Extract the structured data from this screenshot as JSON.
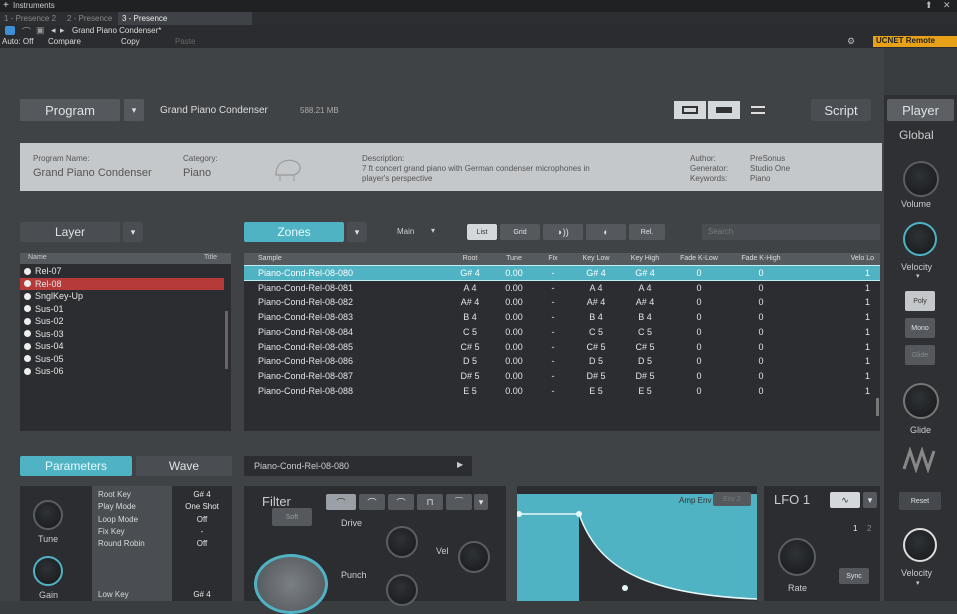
{
  "window": {
    "title": "Instruments",
    "close": "✕",
    "pin": "⬆"
  },
  "tabs": [
    "1 - Presence 2",
    "2 - Presence",
    "3 - Presence"
  ],
  "tab_add": "+",
  "preset": {
    "name": "Grand Piano Condenser*",
    "auto": "Auto: Off",
    "compare": "Compare",
    "copy": "Copy",
    "paste": "Paste",
    "remote": "UCNET Remote"
  },
  "top": {
    "program": "Program",
    "program_name": "Grand Piano Condenser",
    "size": "588.21 MB",
    "script": "Script",
    "player": "Player"
  },
  "info": {
    "program_name_label": "Program Name:",
    "program_name": "Grand Piano Condenser",
    "category_label": "Category:",
    "category": "Piano",
    "description_label": "Description:",
    "description_1": "7 ft concert grand piano with German condenser microphones in",
    "description_2": "player's perspective",
    "author_label": "Author:",
    "author": "PreSonus",
    "generator_label": "Generator:",
    "generator": "Studio One",
    "keywords_label": "Keywords:",
    "keywords": "Piano"
  },
  "global": {
    "title": "Global",
    "volume": "Volume",
    "velocity": "Velocity",
    "poly": "Poly",
    "mono": "Mono",
    "glide_btn": "Glide",
    "glide": "Glide",
    "reset": "Reset",
    "velocity2": "Velocity"
  },
  "layer": {
    "label": "Layer",
    "col_name": "Name",
    "col_title": "Title",
    "items": [
      "Rel-07",
      "Rel-08",
      "SnglKey-Up",
      "Sus-01",
      "Sus-02",
      "Sus-03",
      "Sus-04",
      "Sus-05",
      "Sus-06"
    ]
  },
  "zones": {
    "label": "Zones",
    "main": "Main",
    "list": "List",
    "grid": "Grid",
    "rel": "Rel.",
    "search": "Search",
    "columns": [
      "Sample",
      "Root",
      "Tune",
      "Fix",
      "Key Low",
      "Key High",
      "Fade K-Low",
      "Fade K-High",
      "Velo Lo"
    ],
    "rows": [
      [
        "Piano-Cond-Rel-08-080",
        "G# 4",
        "0.00",
        "-",
        "G# 4",
        "G# 4",
        "0",
        "0",
        "1"
      ],
      [
        "Piano-Cond-Rel-08-081",
        "A 4",
        "0.00",
        "-",
        "A 4",
        "A 4",
        "0",
        "0",
        "1"
      ],
      [
        "Piano-Cond-Rel-08-082",
        "A# 4",
        "0.00",
        "-",
        "A# 4",
        "A# 4",
        "0",
        "0",
        "1"
      ],
      [
        "Piano-Cond-Rel-08-083",
        "B 4",
        "0.00",
        "-",
        "B 4",
        "B 4",
        "0",
        "0",
        "1"
      ],
      [
        "Piano-Cond-Rel-08-084",
        "C 5",
        "0.00",
        "-",
        "C 5",
        "C 5",
        "0",
        "0",
        "1"
      ],
      [
        "Piano-Cond-Rel-08-085",
        "C# 5",
        "0.00",
        "-",
        "C# 5",
        "C# 5",
        "0",
        "0",
        "1"
      ],
      [
        "Piano-Cond-Rel-08-086",
        "D 5",
        "0.00",
        "-",
        "D 5",
        "D 5",
        "0",
        "0",
        "1"
      ],
      [
        "Piano-Cond-Rel-08-087",
        "D# 5",
        "0.00",
        "-",
        "D# 5",
        "D# 5",
        "0",
        "0",
        "1"
      ],
      [
        "Piano-Cond-Rel-08-088",
        "E 5",
        "0.00",
        "-",
        "E 5",
        "E 5",
        "0",
        "0",
        "1"
      ]
    ]
  },
  "bottom": {
    "parameters": "Parameters",
    "wave": "Wave",
    "sample": "Piano-Cond-Rel-08-080",
    "play": "▶",
    "tune": "Tune",
    "gain": "Gain",
    "params": [
      [
        "Root Key",
        "G# 4"
      ],
      [
        "Play Mode",
        "One Shot"
      ],
      [
        "Loop Mode",
        "Off"
      ],
      [
        "Fix Key",
        "-"
      ],
      [
        "Round Robin",
        "Off"
      ],
      [
        "Low Key",
        "G# 4"
      ]
    ],
    "filter": "Filter",
    "soft": "Soft",
    "drive": "Drive",
    "punch": "Punch",
    "vel": "Vel",
    "amp_env": "Amp Env",
    "env2": "Env 2",
    "lfo": "LFO 1",
    "lfo_1": "1",
    "lfo_2": "2",
    "rate": "Rate",
    "sync": "Sync"
  }
}
